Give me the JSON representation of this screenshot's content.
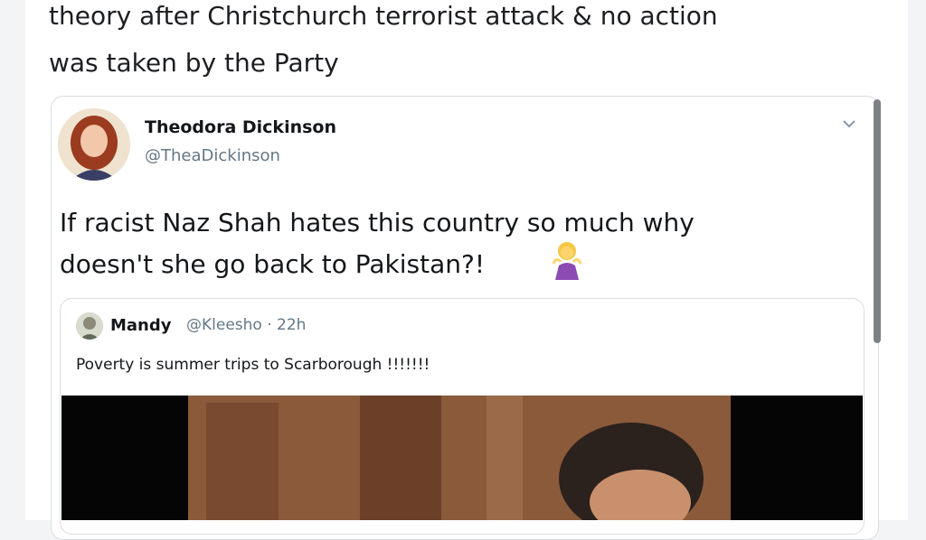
{
  "outer_tweet": {
    "line1": "theory after Christchurch terrorist attack & no action",
    "line2": "was taken by the Party"
  },
  "embedded_tweet": {
    "author_name": "Theodora Dickinson",
    "author_handle": "@TheaDickinson",
    "text_line1": "If racist Naz Shah hates this country so much why",
    "text_line2": "doesn't she go back to Pakistan?!",
    "emoji": "person-shrugging",
    "menu_icon": "chevron-down-icon"
  },
  "quoted_tweet": {
    "author_name": "Mandy",
    "author_handle": "@Kleesho · 22h",
    "text": "Poverty is summer trips to Scarborough !!!!!!!"
  },
  "colors": {
    "text": "#14171a",
    "secondary": "#657786",
    "border": "#d9dde0"
  }
}
